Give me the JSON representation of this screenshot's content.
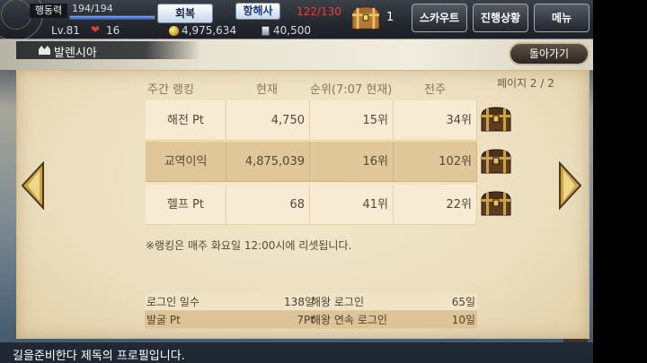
{
  "top_bar": {
    "action_points_label": "행동력",
    "action_points_value": "194/194",
    "action_points_fill": 1.0,
    "recover_button": "회복",
    "navigator_button": "항해사",
    "navigator_count": "122/130",
    "chest_count": "1",
    "scout_button": "스카우트",
    "progress_button": "진행상황",
    "menu_button": "메뉴"
  },
  "player": {
    "level": "Lv.81",
    "hearts": "16",
    "gold": "4,975,634",
    "gems": "40,500",
    "heart_icon": "heart-icon",
    "gold_icon": "coin-icon",
    "gem_icon": "gem-icon"
  },
  "location": {
    "name": "발렌시아",
    "back_button": "돌아가기"
  },
  "ranking": {
    "header_title": "주간 랭킹",
    "header_current": "현재",
    "header_rank": "순위(7:07 현재)",
    "header_last_week": "전주",
    "page_indicator": "페이지 2 / 2",
    "rows": [
      {
        "name": "해전 Pt",
        "current": "4,750",
        "rank": "15위",
        "last_week": "34위",
        "highlighted": false
      },
      {
        "name": "교역이익",
        "current": "4,875,039",
        "rank": "16위",
        "last_week": "102위",
        "highlighted": true
      },
      {
        "name": "헬프 Pt",
        "current": "68",
        "rank": "41위",
        "last_week": "22위",
        "highlighted": false
      }
    ],
    "reset_note": "※랭킹은 매주 화요일 12:00시에 리셋됩니다."
  },
  "stats": {
    "rows": [
      {
        "label_left": "로그인 일수",
        "value_left": "138일",
        "label_right": "해왕 로그인",
        "value_right": "65일"
      },
      {
        "label_left": "발굴 Pt",
        "value_left": "7Pt",
        "label_right": "해왕 연속 로그인",
        "value_right": "10일"
      }
    ]
  },
  "footer": {
    "message": "길을준비한다 제독의 프로필입니다."
  },
  "colors": {
    "navigator_count": "#e0463f",
    "highlight_row": "#dfc79a",
    "parchment": "#efe3c6",
    "action_bar": "#3c66c4"
  }
}
